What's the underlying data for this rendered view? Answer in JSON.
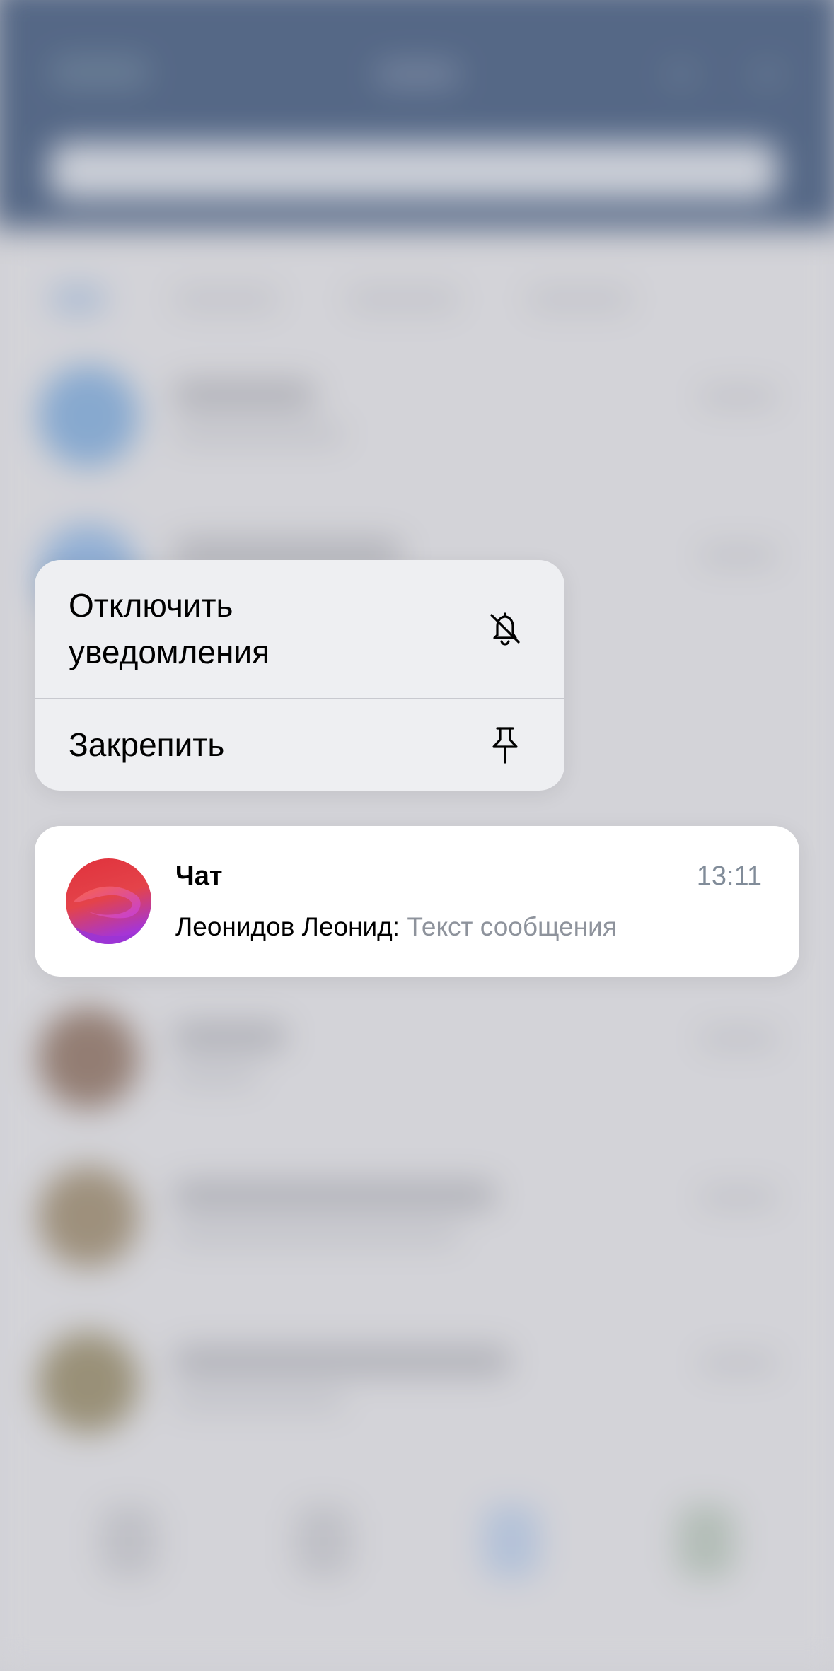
{
  "context_menu": {
    "items": [
      {
        "label": "Отключить\nуведомления",
        "icon": "bell-off-icon"
      },
      {
        "label": "Закрепить",
        "icon": "pin-icon"
      }
    ]
  },
  "chat_preview": {
    "title": "Чат",
    "time": "13:11",
    "sender": "Леонидов Леонид:",
    "message": "Текст сообщения",
    "avatar_colors": [
      "#e0323c",
      "#a535d6"
    ]
  },
  "colors": {
    "header_bg": "#2b446b",
    "menu_bg": "#eeeff2",
    "card_bg": "#ffffff",
    "secondary_text": "#818c99"
  }
}
